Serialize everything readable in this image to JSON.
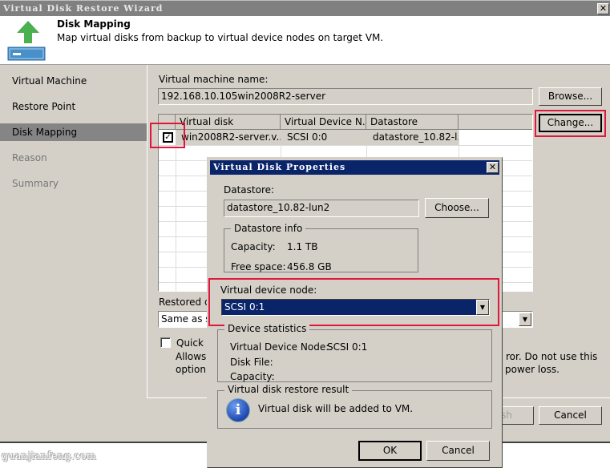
{
  "wizard": {
    "title": "Virtual Disk Restore Wizard",
    "header": {
      "title": "Disk Mapping",
      "description": "Map virtual disks from backup to virtual device nodes on target VM."
    },
    "steps": [
      {
        "label": "Virtual Machine",
        "state": "done"
      },
      {
        "label": "Restore Point",
        "state": "done"
      },
      {
        "label": "Disk Mapping",
        "state": "active"
      },
      {
        "label": "Reason",
        "state": "disabled"
      },
      {
        "label": "Summary",
        "state": "disabled"
      }
    ],
    "vm_name_label": "Virtual machine name:",
    "vm_name_value": "192.168.10.105win2008R2-server",
    "browse_label": "Browse...",
    "change_label": "Change...",
    "disk_table": {
      "columns": [
        "",
        "Virtual disk",
        "Virtual Device N...",
        "Datastore"
      ],
      "rows": [
        {
          "checked": true,
          "virtual_disk": "win2008R2-server.v...",
          "device_node": "SCSI 0:0",
          "datastore": "datastore_10.82-l..."
        }
      ]
    },
    "restored_disk_label": "Restored dis",
    "restored_disk_value": "Same as so",
    "quick_rollback": {
      "checked": false,
      "label": "Quick r",
      "desc_line1_left": "Allows f",
      "desc_line1_right": "ror. Do not use this",
      "desc_line2_left": "option v",
      "desc_line2_right": "power loss."
    },
    "finish_label": "ish",
    "cancel_label": "Cancel"
  },
  "dialog": {
    "title": "Virtual Disk Properties",
    "datastore_label": "Datastore:",
    "datastore_value": "datastore_10.82-lun2",
    "choose_label": "Choose...",
    "datastore_info": {
      "title": "Datastore info",
      "capacity_label": "Capacity:",
      "capacity_value": "1.1 TB",
      "free_label": "Free space:",
      "free_value": "456.8 GB"
    },
    "device_node_label": "Virtual device node:",
    "device_node_value": "SCSI 0:1",
    "device_stats": {
      "title": "Device statistics",
      "node_label": "Virtual Device Node:",
      "node_value": "SCSI 0:1",
      "disk_file_label": "Disk File:",
      "capacity_label": "Capacity:"
    },
    "result": {
      "title": "Virtual disk restore result",
      "message": "Virtual disk will be added to VM."
    },
    "ok_label": "OK",
    "cancel_label": "Cancel"
  },
  "watermark": "guanjianfeng.com",
  "colors": {
    "highlight_red": "#e0163a",
    "title_active": "#0a246a",
    "title_inactive": "#808080",
    "face": "#d4d0c8"
  }
}
